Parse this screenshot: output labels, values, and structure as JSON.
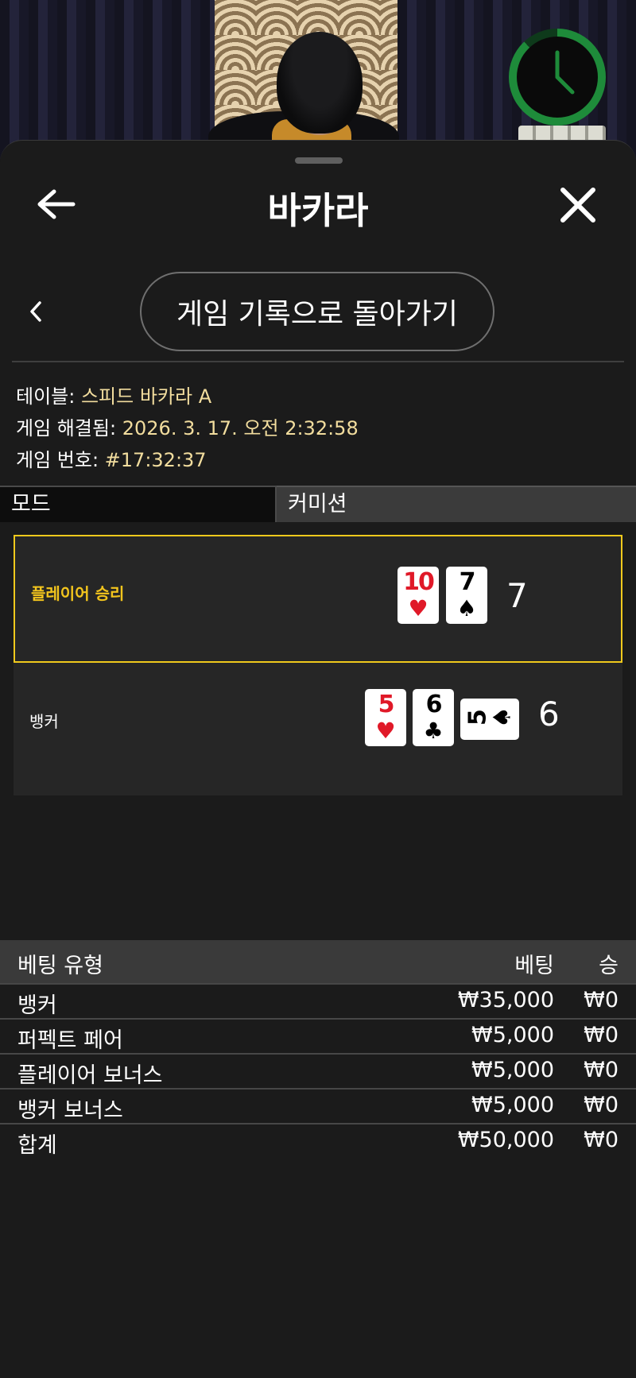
{
  "header": {
    "title": "바카라"
  },
  "nav": {
    "back_to_history": "게임 기록으로 돌아가기"
  },
  "info": {
    "table_label": "테이블: ",
    "table_value": "스피드 바카라 A",
    "resolved_label": "게임 해결됨: ",
    "resolved_value": "2026. 3. 17. 오전 2:32:58",
    "game_no_label": "게임 번호: ",
    "game_no_value": "#17:32:37"
  },
  "mode": {
    "label": "모드",
    "value": "커미션"
  },
  "result": {
    "player": {
      "label": "플레이어 승리",
      "score": "7",
      "cards": [
        {
          "rank": "10",
          "suit": "♥",
          "color": "red"
        },
        {
          "rank": "7",
          "suit": "♠",
          "color": "black"
        }
      ]
    },
    "banker": {
      "label": "뱅커",
      "score": "6",
      "cards": [
        {
          "rank": "5",
          "suit": "♥",
          "color": "red"
        },
        {
          "rank": "6",
          "suit": "♣",
          "color": "black"
        },
        {
          "rank": "5",
          "suit": "♠",
          "color": "black",
          "rotated": true
        }
      ]
    }
  },
  "bets": {
    "headers": {
      "type": "베팅 유형",
      "bet": "베팅",
      "win": "승"
    },
    "rows": [
      {
        "type": "뱅커",
        "bet": "₩35,000",
        "win": "₩0"
      },
      {
        "type": "퍼펙트 페어",
        "bet": "₩5,000",
        "win": "₩0"
      },
      {
        "type": "플레이어 보너스",
        "bet": "₩5,000",
        "win": "₩0"
      },
      {
        "type": "뱅커 보너스",
        "bet": "₩5,000",
        "win": "₩0"
      }
    ],
    "total": {
      "type": "합계",
      "bet": "₩50,000",
      "win": "₩0"
    }
  },
  "colors": {
    "accent_yellow": "#f0c91c",
    "value_text": "#f2dd9e",
    "timer_green": "#1e8b3a",
    "card_red": "#e01928"
  },
  "icons": {
    "back": "arrow-left-icon",
    "close": "close-icon",
    "sub_back": "chevron-left-icon",
    "timer": "clock-icon"
  }
}
